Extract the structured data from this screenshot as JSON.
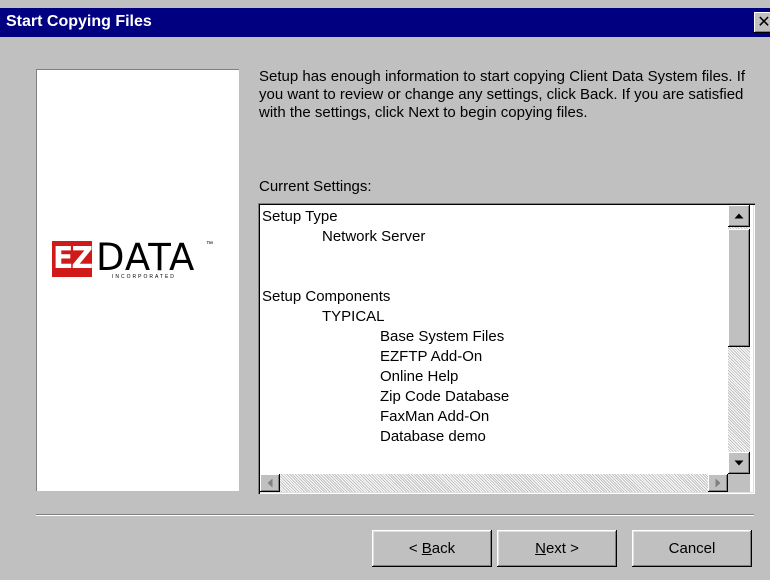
{
  "window": {
    "title": "Start Copying Files",
    "close_glyph": "✕"
  },
  "logo": {
    "mark": "EZ",
    "word": "DATA",
    "tm": "™",
    "sub": "INCORPORATED"
  },
  "description": "Setup has enough information to start copying Client Data System files. If you want to review or change any settings, click Back.  If you are satisfied with the settings, click Next to begin copying files.",
  "settings": {
    "label": "Current Settings:",
    "lines": [
      {
        "text": "Setup Type",
        "indent": 0
      },
      {
        "text": "Network Server",
        "indent": 1
      },
      {
        "text": "",
        "indent": 0
      },
      {
        "text": "",
        "indent": 0
      },
      {
        "text": "Setup Components",
        "indent": 0
      },
      {
        "text": "TYPICAL",
        "indent": 1
      },
      {
        "text": "Base System Files",
        "indent": 2
      },
      {
        "text": "EZFTP Add-On",
        "indent": 2
      },
      {
        "text": "Online Help",
        "indent": 2
      },
      {
        "text": "Zip Code Database",
        "indent": 2
      },
      {
        "text": "FaxMan Add-On",
        "indent": 2
      },
      {
        "text": "Database demo",
        "indent": 2
      }
    ]
  },
  "buttons": {
    "back": {
      "prefix": "< ",
      "accel": "B",
      "rest": "ack"
    },
    "next": {
      "accel": "N",
      "rest": "ext >"
    },
    "cancel": "Cancel"
  }
}
